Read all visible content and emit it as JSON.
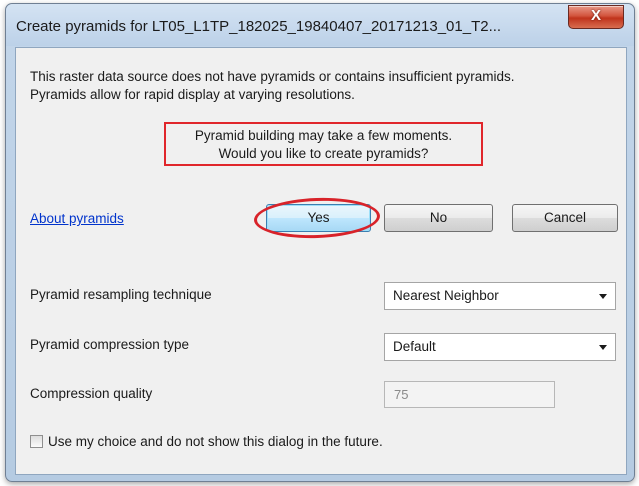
{
  "window": {
    "title": "Create pyramids for LT05_L1TP_182025_19840407_20171213_01_T2...",
    "close_label": "X"
  },
  "message": {
    "line1": "This raster data source does not have pyramids or contains insufficient pyramids.",
    "line2": "Pyramids allow for rapid display at varying resolutions."
  },
  "notice": {
    "line1": "Pyramid building may take a few moments.",
    "line2": "Would you like to create pyramids?"
  },
  "about_link": "About pyramids",
  "buttons": {
    "yes": "Yes",
    "no": "No",
    "cancel": "Cancel"
  },
  "settings": {
    "resampling_label": "Pyramid resampling technique",
    "resampling_value": "Nearest Neighbor",
    "compression_label": "Pyramid compression type",
    "compression_value": "Default",
    "quality_label": "Compression quality",
    "quality_value": "75"
  },
  "checkbox": {
    "label": "Use my choice and do not show this dialog in the future.",
    "checked": false
  },
  "colors": {
    "highlight": "#e0262b",
    "link": "#0033cc",
    "close_button": "#c0331c"
  }
}
